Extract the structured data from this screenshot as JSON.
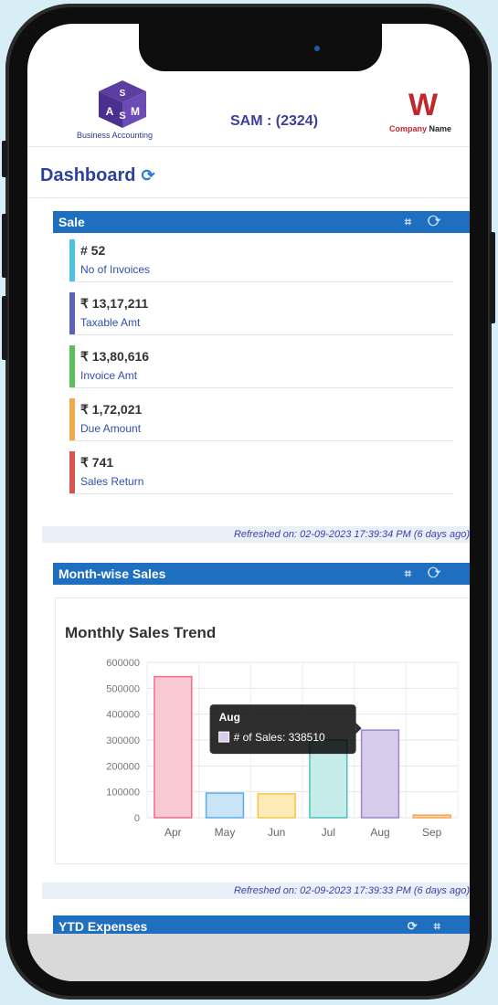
{
  "header": {
    "logo_letters": [
      "S",
      "A",
      "S",
      "M"
    ],
    "logo_subtitle": "Business Accounting",
    "title": "SAM : (2324)",
    "company_logo_letter": "W",
    "company_name_colored": "Company",
    "company_name_bold": "Name"
  },
  "dashboard": {
    "title": "Dashboard",
    "refresh_icon": "refresh-icon"
  },
  "sale_panel": {
    "title": "Sale",
    "icons": [
      "crop-icon",
      "refresh-icon"
    ],
    "stats": [
      {
        "value": "# 52",
        "label": "No of Invoices",
        "color": "#4fc3e0"
      },
      {
        "value": "₹ 13,17,211",
        "label": "Taxable Amt",
        "color": "#5b63b8"
      },
      {
        "value": "₹ 13,80,616",
        "label": "Invoice Amt",
        "color": "#5cbf5a"
      },
      {
        "value": "₹ 1,72,021",
        "label": "Due Amount",
        "color": "#f2a94c"
      },
      {
        "value": "₹ 741",
        "label": "Sales Return",
        "color": "#d9534f"
      }
    ],
    "refreshed": "Refreshed on: 02-09-2023 17:39:34 PM (6 days ago)"
  },
  "month_panel": {
    "title": "Month-wise Sales",
    "icons": [
      "crop-icon",
      "refresh-icon"
    ],
    "refreshed": "Refreshed on: 02-09-2023 17:39:33 PM (6 days ago)"
  },
  "chart_data": {
    "type": "bar",
    "title": "Monthly Sales Trend",
    "categories": [
      "Apr",
      "May",
      "Jun",
      "Jul",
      "Aug",
      "Sep"
    ],
    "series": [
      {
        "name": "# of Sales",
        "values": [
          545000,
          95000,
          92000,
          300000,
          338510,
          10000
        ]
      }
    ],
    "yticks": [
      "600000",
      "500000",
      "400000",
      "300000",
      "200000",
      "100000",
      "0"
    ],
    "ylim": [
      0,
      600000
    ],
    "colors": [
      "#f7c9d3",
      "#c8e4f6",
      "#fdebb8",
      "#c6ecea",
      "#d7cdeb",
      "#fde0c0"
    ],
    "strokes": [
      "#ef6b86",
      "#58aee6",
      "#f5c543",
      "#4dbfb9",
      "#9b84cc",
      "#f7a24a"
    ],
    "tooltip": {
      "title": "Aug",
      "label": "# of Sales: 338510"
    },
    "grid": true
  },
  "ytd_panel": {
    "title": "YTD Expenses",
    "icons": [
      "refresh-icon",
      "crop-icon"
    ]
  }
}
